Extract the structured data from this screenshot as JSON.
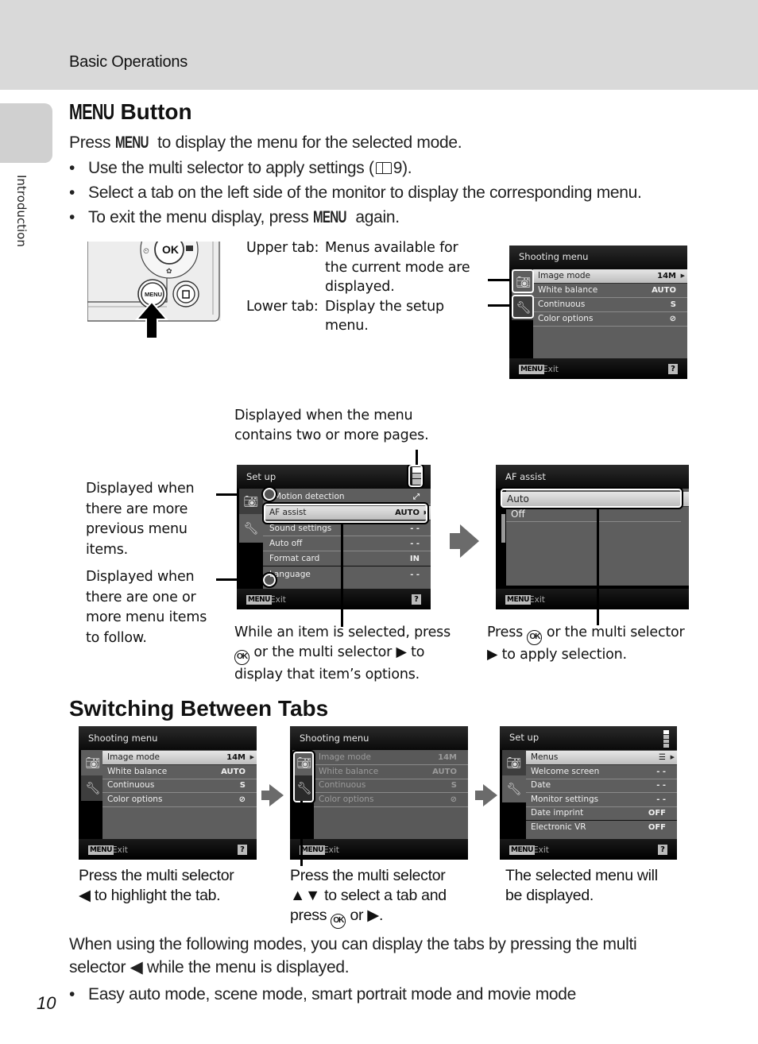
{
  "header": {
    "section": "Basic Operations"
  },
  "side_tab": {
    "label": "Introduction"
  },
  "section1": {
    "title_glyph": "MENU",
    "title_rest": "Button",
    "intro_pre": "Press",
    "intro_glyph": "MENU",
    "intro_post": "to display the menu for the selected mode.",
    "bullets": [
      "Use the multi selector to apply settings (",
      "Select a tab on the left side of the monitor to display the corresponding menu.",
      "To exit the menu display, press"
    ],
    "bullet1_ref_icon": "book-icon",
    "bullet1_ref_page": "9).",
    "bullet3_glyph": "MENU",
    "bullet3_post": "again."
  },
  "camera_illustration": {
    "ok_label": "OK",
    "menu_label": "MENU"
  },
  "tab_legend": {
    "upper_label": "Upper tab:",
    "upper_lines": [
      "Menus available for",
      "the current mode are",
      "displayed."
    ],
    "lower_label": "Lower tab:",
    "lower_lines": [
      "Display the setup",
      "menu."
    ]
  },
  "screen_shooting_top": {
    "title": "Shooting menu",
    "rows": [
      {
        "label": "Image mode",
        "value": "14M",
        "selected": true
      },
      {
        "label": "White balance",
        "value": "AUTO"
      },
      {
        "label": "Continuous",
        "value": "S"
      },
      {
        "label": "Color options",
        "value": "⊘"
      }
    ],
    "exit_chip": "MENU",
    "exit_label": "Exit",
    "help": "?"
  },
  "callouts": {
    "pages": [
      "Displayed when the menu",
      "contains two or more pages."
    ],
    "previous": [
      "Displayed when",
      "there are more",
      "previous menu",
      "items."
    ],
    "follow": [
      "Displayed when",
      "there are one or",
      "more menu items",
      "to follow."
    ],
    "selected_pre": "While an item is selected, press",
    "selected_mid": "or the multi selector ▶ to",
    "selected_end": "display that item’s options.",
    "apply_pre": "Press",
    "apply_mid": "or the multi selector",
    "apply_end": "▶ to apply selection."
  },
  "screen_setup": {
    "title": "Set up",
    "rows": [
      {
        "label": "Motion detection",
        "value": "⤢"
      },
      {
        "label": "AF assist",
        "value": "AUTO",
        "selected": true
      },
      {
        "label": "Sound settings",
        "value": "- -"
      },
      {
        "label": "Auto off",
        "value": "- -"
      },
      {
        "label": "Format card",
        "value": "IN"
      },
      {
        "label": "Language",
        "value": "- -"
      }
    ],
    "exit_chip": "MENU",
    "exit_label": "Exit",
    "help": "?"
  },
  "screen_af_assist": {
    "title": "AF assist",
    "options": [
      {
        "label": "Auto",
        "selected": true
      },
      {
        "label": "Off"
      }
    ],
    "exit_chip": "MENU",
    "exit_label": "Exit"
  },
  "section2": {
    "title": "Switching Between Tabs",
    "screen1": {
      "title": "Shooting menu",
      "rows": [
        {
          "label": "Image mode",
          "value": "14M",
          "selected": true
        },
        {
          "label": "White balance",
          "value": "AUTO"
        },
        {
          "label": "Continuous",
          "value": "S"
        },
        {
          "label": "Color options",
          "value": "⊘"
        }
      ],
      "exit_chip": "MENU",
      "exit_label": "Exit",
      "help": "?"
    },
    "screen2": {
      "title": "Shooting menu",
      "rows": [
        {
          "label": "Image mode",
          "value": "14M"
        },
        {
          "label": "White balance",
          "value": "AUTO"
        },
        {
          "label": "Continuous",
          "value": "S"
        },
        {
          "label": "Color options",
          "value": "⊘"
        }
      ],
      "exit_chip": "MENU",
      "exit_label": "Exit"
    },
    "screen3": {
      "title": "Set up",
      "rows": [
        {
          "label": "Menus",
          "value": "☰",
          "selected": true
        },
        {
          "label": "Welcome screen",
          "value": "- -"
        },
        {
          "label": "Date",
          "value": "- -"
        },
        {
          "label": "Monitor settings",
          "value": "- -"
        },
        {
          "label": "Date imprint",
          "value": "OFF"
        },
        {
          "label": "Electronic VR",
          "value": "OFF"
        }
      ],
      "exit_chip": "MENU",
      "exit_label": "Exit",
      "help": "?"
    },
    "caption1": [
      "Press the multi selector",
      "◀ to highlight the tab."
    ],
    "caption2_lines": [
      "Press the multi selector",
      "▲▼ to select a tab and"
    ],
    "caption2_last_pre": "press",
    "caption2_last_post": "or ▶.",
    "caption3": [
      "The selected menu will",
      "be displayed."
    ],
    "note_lines": [
      "When using the following modes, you can display the tabs by pressing the multi",
      "selector ◀ while the menu is displayed."
    ],
    "note_bullet": "Easy auto mode, scene mode, smart portrait mode and movie mode"
  },
  "ok_symbol": "OK",
  "page_number": "10"
}
